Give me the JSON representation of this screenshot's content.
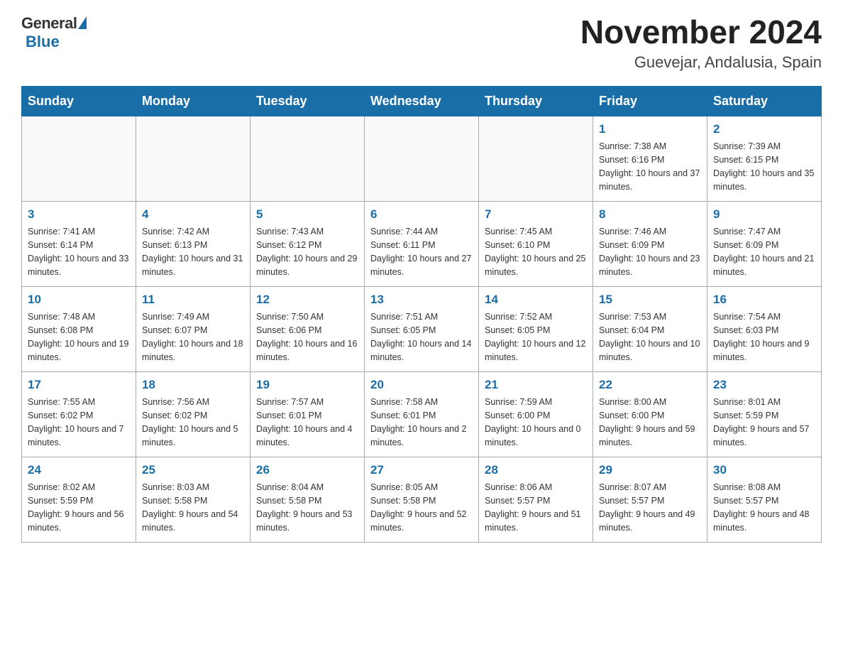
{
  "header": {
    "logo_general": "General",
    "logo_blue": "Blue",
    "title": "November 2024",
    "subtitle": "Guevejar, Andalusia, Spain"
  },
  "weekdays": [
    "Sunday",
    "Monday",
    "Tuesday",
    "Wednesday",
    "Thursday",
    "Friday",
    "Saturday"
  ],
  "weeks": [
    [
      {
        "day": "",
        "sunrise": "",
        "sunset": "",
        "daylight": ""
      },
      {
        "day": "",
        "sunrise": "",
        "sunset": "",
        "daylight": ""
      },
      {
        "day": "",
        "sunrise": "",
        "sunset": "",
        "daylight": ""
      },
      {
        "day": "",
        "sunrise": "",
        "sunset": "",
        "daylight": ""
      },
      {
        "day": "",
        "sunrise": "",
        "sunset": "",
        "daylight": ""
      },
      {
        "day": "1",
        "sunrise": "Sunrise: 7:38 AM",
        "sunset": "Sunset: 6:16 PM",
        "daylight": "Daylight: 10 hours and 37 minutes."
      },
      {
        "day": "2",
        "sunrise": "Sunrise: 7:39 AM",
        "sunset": "Sunset: 6:15 PM",
        "daylight": "Daylight: 10 hours and 35 minutes."
      }
    ],
    [
      {
        "day": "3",
        "sunrise": "Sunrise: 7:41 AM",
        "sunset": "Sunset: 6:14 PM",
        "daylight": "Daylight: 10 hours and 33 minutes."
      },
      {
        "day": "4",
        "sunrise": "Sunrise: 7:42 AM",
        "sunset": "Sunset: 6:13 PM",
        "daylight": "Daylight: 10 hours and 31 minutes."
      },
      {
        "day": "5",
        "sunrise": "Sunrise: 7:43 AM",
        "sunset": "Sunset: 6:12 PM",
        "daylight": "Daylight: 10 hours and 29 minutes."
      },
      {
        "day": "6",
        "sunrise": "Sunrise: 7:44 AM",
        "sunset": "Sunset: 6:11 PM",
        "daylight": "Daylight: 10 hours and 27 minutes."
      },
      {
        "day": "7",
        "sunrise": "Sunrise: 7:45 AM",
        "sunset": "Sunset: 6:10 PM",
        "daylight": "Daylight: 10 hours and 25 minutes."
      },
      {
        "day": "8",
        "sunrise": "Sunrise: 7:46 AM",
        "sunset": "Sunset: 6:09 PM",
        "daylight": "Daylight: 10 hours and 23 minutes."
      },
      {
        "day": "9",
        "sunrise": "Sunrise: 7:47 AM",
        "sunset": "Sunset: 6:09 PM",
        "daylight": "Daylight: 10 hours and 21 minutes."
      }
    ],
    [
      {
        "day": "10",
        "sunrise": "Sunrise: 7:48 AM",
        "sunset": "Sunset: 6:08 PM",
        "daylight": "Daylight: 10 hours and 19 minutes."
      },
      {
        "day": "11",
        "sunrise": "Sunrise: 7:49 AM",
        "sunset": "Sunset: 6:07 PM",
        "daylight": "Daylight: 10 hours and 18 minutes."
      },
      {
        "day": "12",
        "sunrise": "Sunrise: 7:50 AM",
        "sunset": "Sunset: 6:06 PM",
        "daylight": "Daylight: 10 hours and 16 minutes."
      },
      {
        "day": "13",
        "sunrise": "Sunrise: 7:51 AM",
        "sunset": "Sunset: 6:05 PM",
        "daylight": "Daylight: 10 hours and 14 minutes."
      },
      {
        "day": "14",
        "sunrise": "Sunrise: 7:52 AM",
        "sunset": "Sunset: 6:05 PM",
        "daylight": "Daylight: 10 hours and 12 minutes."
      },
      {
        "day": "15",
        "sunrise": "Sunrise: 7:53 AM",
        "sunset": "Sunset: 6:04 PM",
        "daylight": "Daylight: 10 hours and 10 minutes."
      },
      {
        "day": "16",
        "sunrise": "Sunrise: 7:54 AM",
        "sunset": "Sunset: 6:03 PM",
        "daylight": "Daylight: 10 hours and 9 minutes."
      }
    ],
    [
      {
        "day": "17",
        "sunrise": "Sunrise: 7:55 AM",
        "sunset": "Sunset: 6:02 PM",
        "daylight": "Daylight: 10 hours and 7 minutes."
      },
      {
        "day": "18",
        "sunrise": "Sunrise: 7:56 AM",
        "sunset": "Sunset: 6:02 PM",
        "daylight": "Daylight: 10 hours and 5 minutes."
      },
      {
        "day": "19",
        "sunrise": "Sunrise: 7:57 AM",
        "sunset": "Sunset: 6:01 PM",
        "daylight": "Daylight: 10 hours and 4 minutes."
      },
      {
        "day": "20",
        "sunrise": "Sunrise: 7:58 AM",
        "sunset": "Sunset: 6:01 PM",
        "daylight": "Daylight: 10 hours and 2 minutes."
      },
      {
        "day": "21",
        "sunrise": "Sunrise: 7:59 AM",
        "sunset": "Sunset: 6:00 PM",
        "daylight": "Daylight: 10 hours and 0 minutes."
      },
      {
        "day": "22",
        "sunrise": "Sunrise: 8:00 AM",
        "sunset": "Sunset: 6:00 PM",
        "daylight": "Daylight: 9 hours and 59 minutes."
      },
      {
        "day": "23",
        "sunrise": "Sunrise: 8:01 AM",
        "sunset": "Sunset: 5:59 PM",
        "daylight": "Daylight: 9 hours and 57 minutes."
      }
    ],
    [
      {
        "day": "24",
        "sunrise": "Sunrise: 8:02 AM",
        "sunset": "Sunset: 5:59 PM",
        "daylight": "Daylight: 9 hours and 56 minutes."
      },
      {
        "day": "25",
        "sunrise": "Sunrise: 8:03 AM",
        "sunset": "Sunset: 5:58 PM",
        "daylight": "Daylight: 9 hours and 54 minutes."
      },
      {
        "day": "26",
        "sunrise": "Sunrise: 8:04 AM",
        "sunset": "Sunset: 5:58 PM",
        "daylight": "Daylight: 9 hours and 53 minutes."
      },
      {
        "day": "27",
        "sunrise": "Sunrise: 8:05 AM",
        "sunset": "Sunset: 5:58 PM",
        "daylight": "Daylight: 9 hours and 52 minutes."
      },
      {
        "day": "28",
        "sunrise": "Sunrise: 8:06 AM",
        "sunset": "Sunset: 5:57 PM",
        "daylight": "Daylight: 9 hours and 51 minutes."
      },
      {
        "day": "29",
        "sunrise": "Sunrise: 8:07 AM",
        "sunset": "Sunset: 5:57 PM",
        "daylight": "Daylight: 9 hours and 49 minutes."
      },
      {
        "day": "30",
        "sunrise": "Sunrise: 8:08 AM",
        "sunset": "Sunset: 5:57 PM",
        "daylight": "Daylight: 9 hours and 48 minutes."
      }
    ]
  ]
}
